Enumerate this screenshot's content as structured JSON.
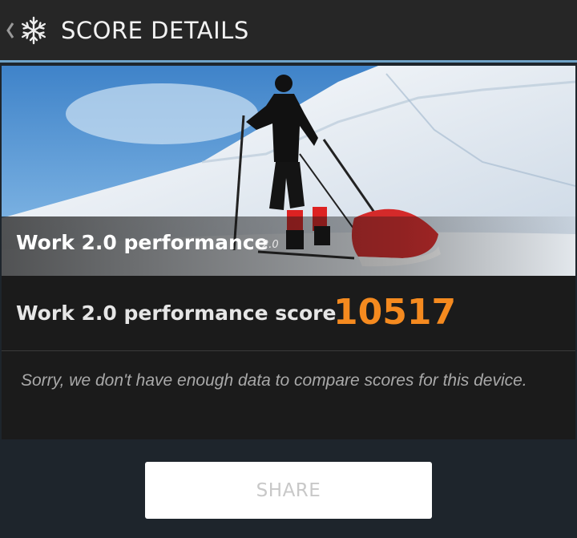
{
  "header": {
    "title": "SCORE DETAILS",
    "back_icon": "chevron-left-icon",
    "app_icon": "snowflake-icon"
  },
  "test": {
    "name": "Work 2.0 performance",
    "version": "2.0",
    "score_label": "Work 2.0 performance score",
    "score_value": "10517",
    "note": "Sorry, we don't have enough data to compare scores for this device."
  },
  "actions": {
    "share_label": "SHARE"
  },
  "colors": {
    "accent": "#6fa3c8",
    "score": "#f58a1f",
    "background": "#1e252c",
    "card": "#1b1b1b"
  }
}
